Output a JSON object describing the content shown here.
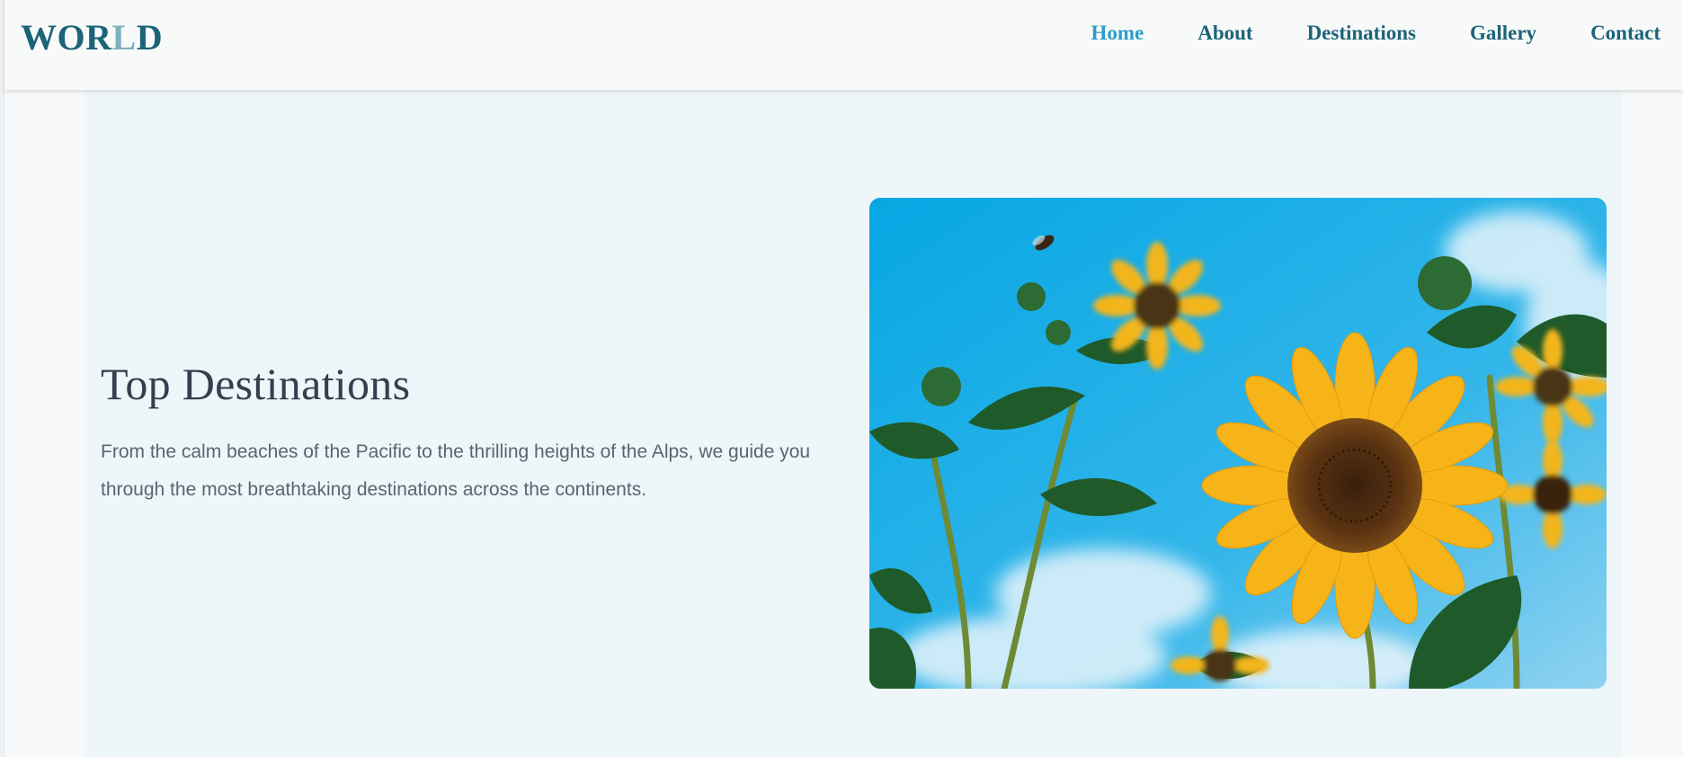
{
  "header": {
    "logo_main": "WOR",
    "logo_fade": "L",
    "logo_end": "D",
    "nav": [
      {
        "label": "Home",
        "active": true
      },
      {
        "label": "About",
        "active": false
      },
      {
        "label": "Destinations",
        "active": false
      },
      {
        "label": "Gallery",
        "active": false
      },
      {
        "label": "Contact",
        "active": false
      }
    ]
  },
  "hero": {
    "title": "Top Destinations",
    "text": "From the calm beaches of the Pacific to the thrilling heights of the Alps, we guide you through the most breathtaking destinations across the continents.",
    "image_subject": "sunflowers against blue sky"
  },
  "colors": {
    "brand": "#1c6478",
    "nav_active": "#2a9dc9",
    "hero_bg": "#eef6f9",
    "title": "#34404f",
    "body_text": "#5a6572"
  }
}
